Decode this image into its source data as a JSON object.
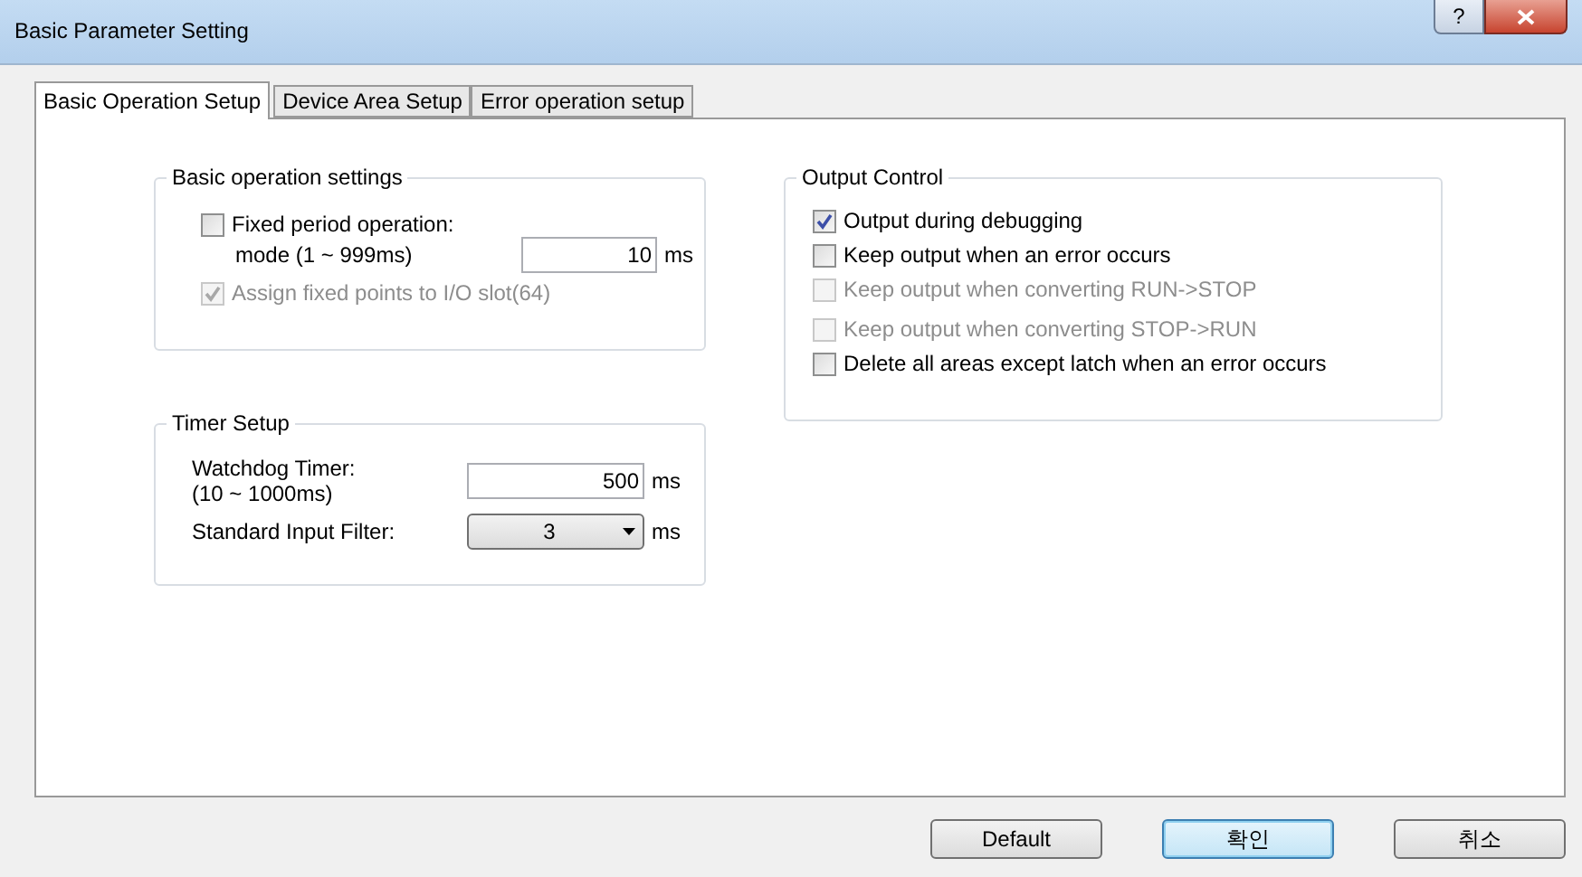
{
  "window": {
    "title": "Basic Parameter Setting",
    "help": "?"
  },
  "tabs": [
    {
      "label": "Basic Operation Setup",
      "selected": true
    },
    {
      "label": "Device Area Setup",
      "selected": false
    },
    {
      "label": "Error operation setup",
      "selected": false
    }
  ],
  "basic_operation": {
    "title": "Basic operation settings",
    "fixed_period": {
      "label": "Fixed period operation:",
      "label_2": "mode (1 ~ 999ms)",
      "checked": false,
      "disabled": false,
      "value": "10",
      "unit": "ms"
    },
    "assign": {
      "label": "Assign fixed points to I/O slot(64)",
      "checked": true,
      "disabled": true
    }
  },
  "timer": {
    "title": "Timer Setup",
    "watchdog": {
      "label": "Watchdog Timer:",
      "label_2": "(10 ~ 1000ms)",
      "value": "500",
      "unit": "ms"
    },
    "filter": {
      "label": "Standard Input Filter:",
      "value": "3",
      "unit": "ms"
    }
  },
  "output_control": {
    "title": "Output Control",
    "options": [
      {
        "label": "Output during debugging",
        "checked": true,
        "disabled": false
      },
      {
        "label": "Keep output when an error occurs",
        "checked": false,
        "disabled": false
      },
      {
        "label": "Keep output when converting RUN->STOP",
        "checked": false,
        "disabled": true
      },
      {
        "label": "Keep output when converting STOP->RUN",
        "checked": false,
        "disabled": true
      },
      {
        "label": "Delete all areas except latch when an error occurs",
        "checked": false,
        "disabled": false
      }
    ]
  },
  "buttons": [
    {
      "label": "Default",
      "focused": false
    },
    {
      "label": "확인",
      "focused": true
    },
    {
      "label": "취소",
      "focused": false
    }
  ]
}
